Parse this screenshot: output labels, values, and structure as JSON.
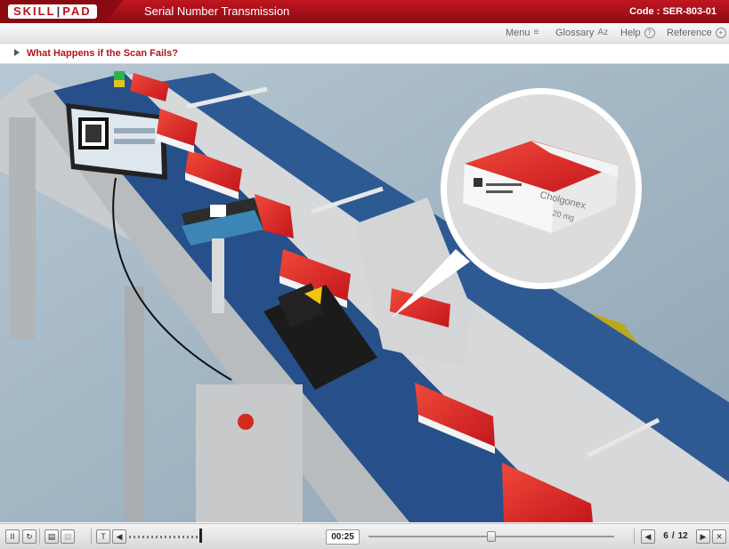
{
  "header": {
    "logo_left": "SKILL",
    "logo_right": "PAD",
    "title": "Serial Number Transmission",
    "code_label": "Code :",
    "code_value": "SER-803-01"
  },
  "menubar": {
    "items": [
      {
        "label": "Menu",
        "icon": "list-icon"
      },
      {
        "label": "Glossary",
        "icon": "az-icon"
      },
      {
        "label": "Help",
        "icon": "question-icon"
      },
      {
        "label": "Reference",
        "icon": "plus-icon"
      }
    ],
    "az_glyph": "Az",
    "help_glyph": "?",
    "ref_glyph": "+",
    "menu_glyph": "≡"
  },
  "section": {
    "title": "What Happens if the Scan Fails?"
  },
  "scene": {
    "box_brand": "Cholgonex",
    "box_dose": "20 mg",
    "colors": {
      "belt": "#274f86",
      "box_red": "#d82a22",
      "frame": "#c9ccce",
      "bin": "#b8a81c",
      "bg": "#9fb4c2"
    }
  },
  "footer": {
    "pause": "II",
    "replay": "↻",
    "notes": "▤",
    "transcript": "T",
    "volume_icon": "◀",
    "time": "00:25",
    "progress": 0.5,
    "prev": "◀",
    "page_current": "6",
    "page_sep": "/",
    "page_total": "12",
    "next": "▶",
    "close": "✕"
  },
  "colors": {
    "brand_red": "#b5121b",
    "header_dark": "#8e0a12"
  }
}
